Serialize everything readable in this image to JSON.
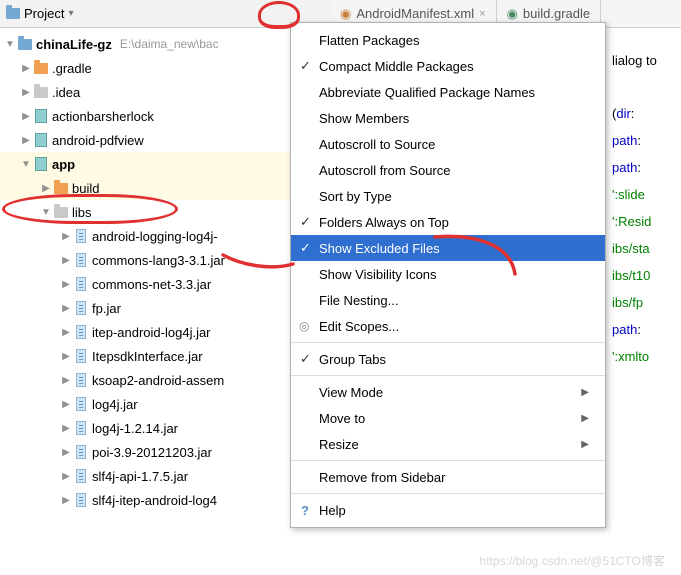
{
  "toolbar": {
    "title": "Project",
    "dropdown_icon": "▾"
  },
  "project": {
    "root": {
      "name": "chinaLife-gz",
      "path": "E:\\daima_new\\bac"
    },
    "items": [
      {
        "name": ".gradle",
        "type": "gradle"
      },
      {
        "name": ".idea",
        "type": "gray"
      },
      {
        "name": "actionbarsherlock",
        "type": "teal"
      },
      {
        "name": "android-pdfview",
        "type": "teal"
      },
      {
        "name": "app",
        "type": "teal",
        "expanded": true,
        "children": [
          {
            "name": "build",
            "type": "gradle"
          },
          {
            "name": "libs",
            "type": "gray",
            "expanded": true,
            "children": [
              "android-logging-log4j-",
              "commons-lang3-3.1.jar",
              "commons-net-3.3.jar",
              "fp.jar",
              "itep-android-log4j.jar",
              "ItepsdkInterface.jar",
              "ksoap2-android-assem",
              "log4j.jar",
              "log4j-1.2.14.jar",
              "poi-3.9-20121203.jar",
              "slf4j-api-1.7.5.jar",
              "slf4j-itep-android-log4"
            ]
          }
        ]
      }
    ]
  },
  "tabs": [
    {
      "label": "AndroidManifest.xml"
    },
    {
      "label": "build.gradle"
    }
  ],
  "editor": {
    "l1": "lialog to",
    "l2": "(",
    "l2b": "dir",
    "l2c": ":",
    "l3": "path",
    "l3b": ":",
    "l4": "path",
    "l4b": ":",
    "l5": "':slide",
    "l6": "':Resid",
    "l7": "ibs/sta",
    "l8": "ibs/t10",
    "l9": "ibs/fp",
    "l10": "path",
    "l10b": ":",
    "l11": "':xmlto"
  },
  "menu": {
    "items": [
      {
        "label": "Flatten Packages"
      },
      {
        "label": "Compact Middle Packages",
        "checked": true
      },
      {
        "label": "Abbreviate Qualified Package Names"
      },
      {
        "label": "Show Members"
      },
      {
        "label": "Autoscroll to Source"
      },
      {
        "label": "Autoscroll from Source"
      },
      {
        "label": "Sort by Type"
      },
      {
        "label": "Folders Always on Top",
        "checked": true
      },
      {
        "label": "Show Excluded Files",
        "checked": true,
        "selected": true
      },
      {
        "label": "Show Visibility Icons"
      },
      {
        "label": "File Nesting..."
      },
      {
        "label": "Edit Scopes...",
        "radio": true
      },
      {
        "sep": true
      },
      {
        "label": "Group Tabs",
        "checked": true
      },
      {
        "sep": true
      },
      {
        "label": "View Mode",
        "sub": true
      },
      {
        "label": "Move to",
        "sub": true
      },
      {
        "label": "Resize",
        "sub": true
      },
      {
        "sep": true
      },
      {
        "label": "Remove from Sidebar"
      },
      {
        "sep": true
      },
      {
        "label": "Help",
        "q": true
      }
    ]
  },
  "watermark": "https://blog.csdn.net/@51CTO博客"
}
